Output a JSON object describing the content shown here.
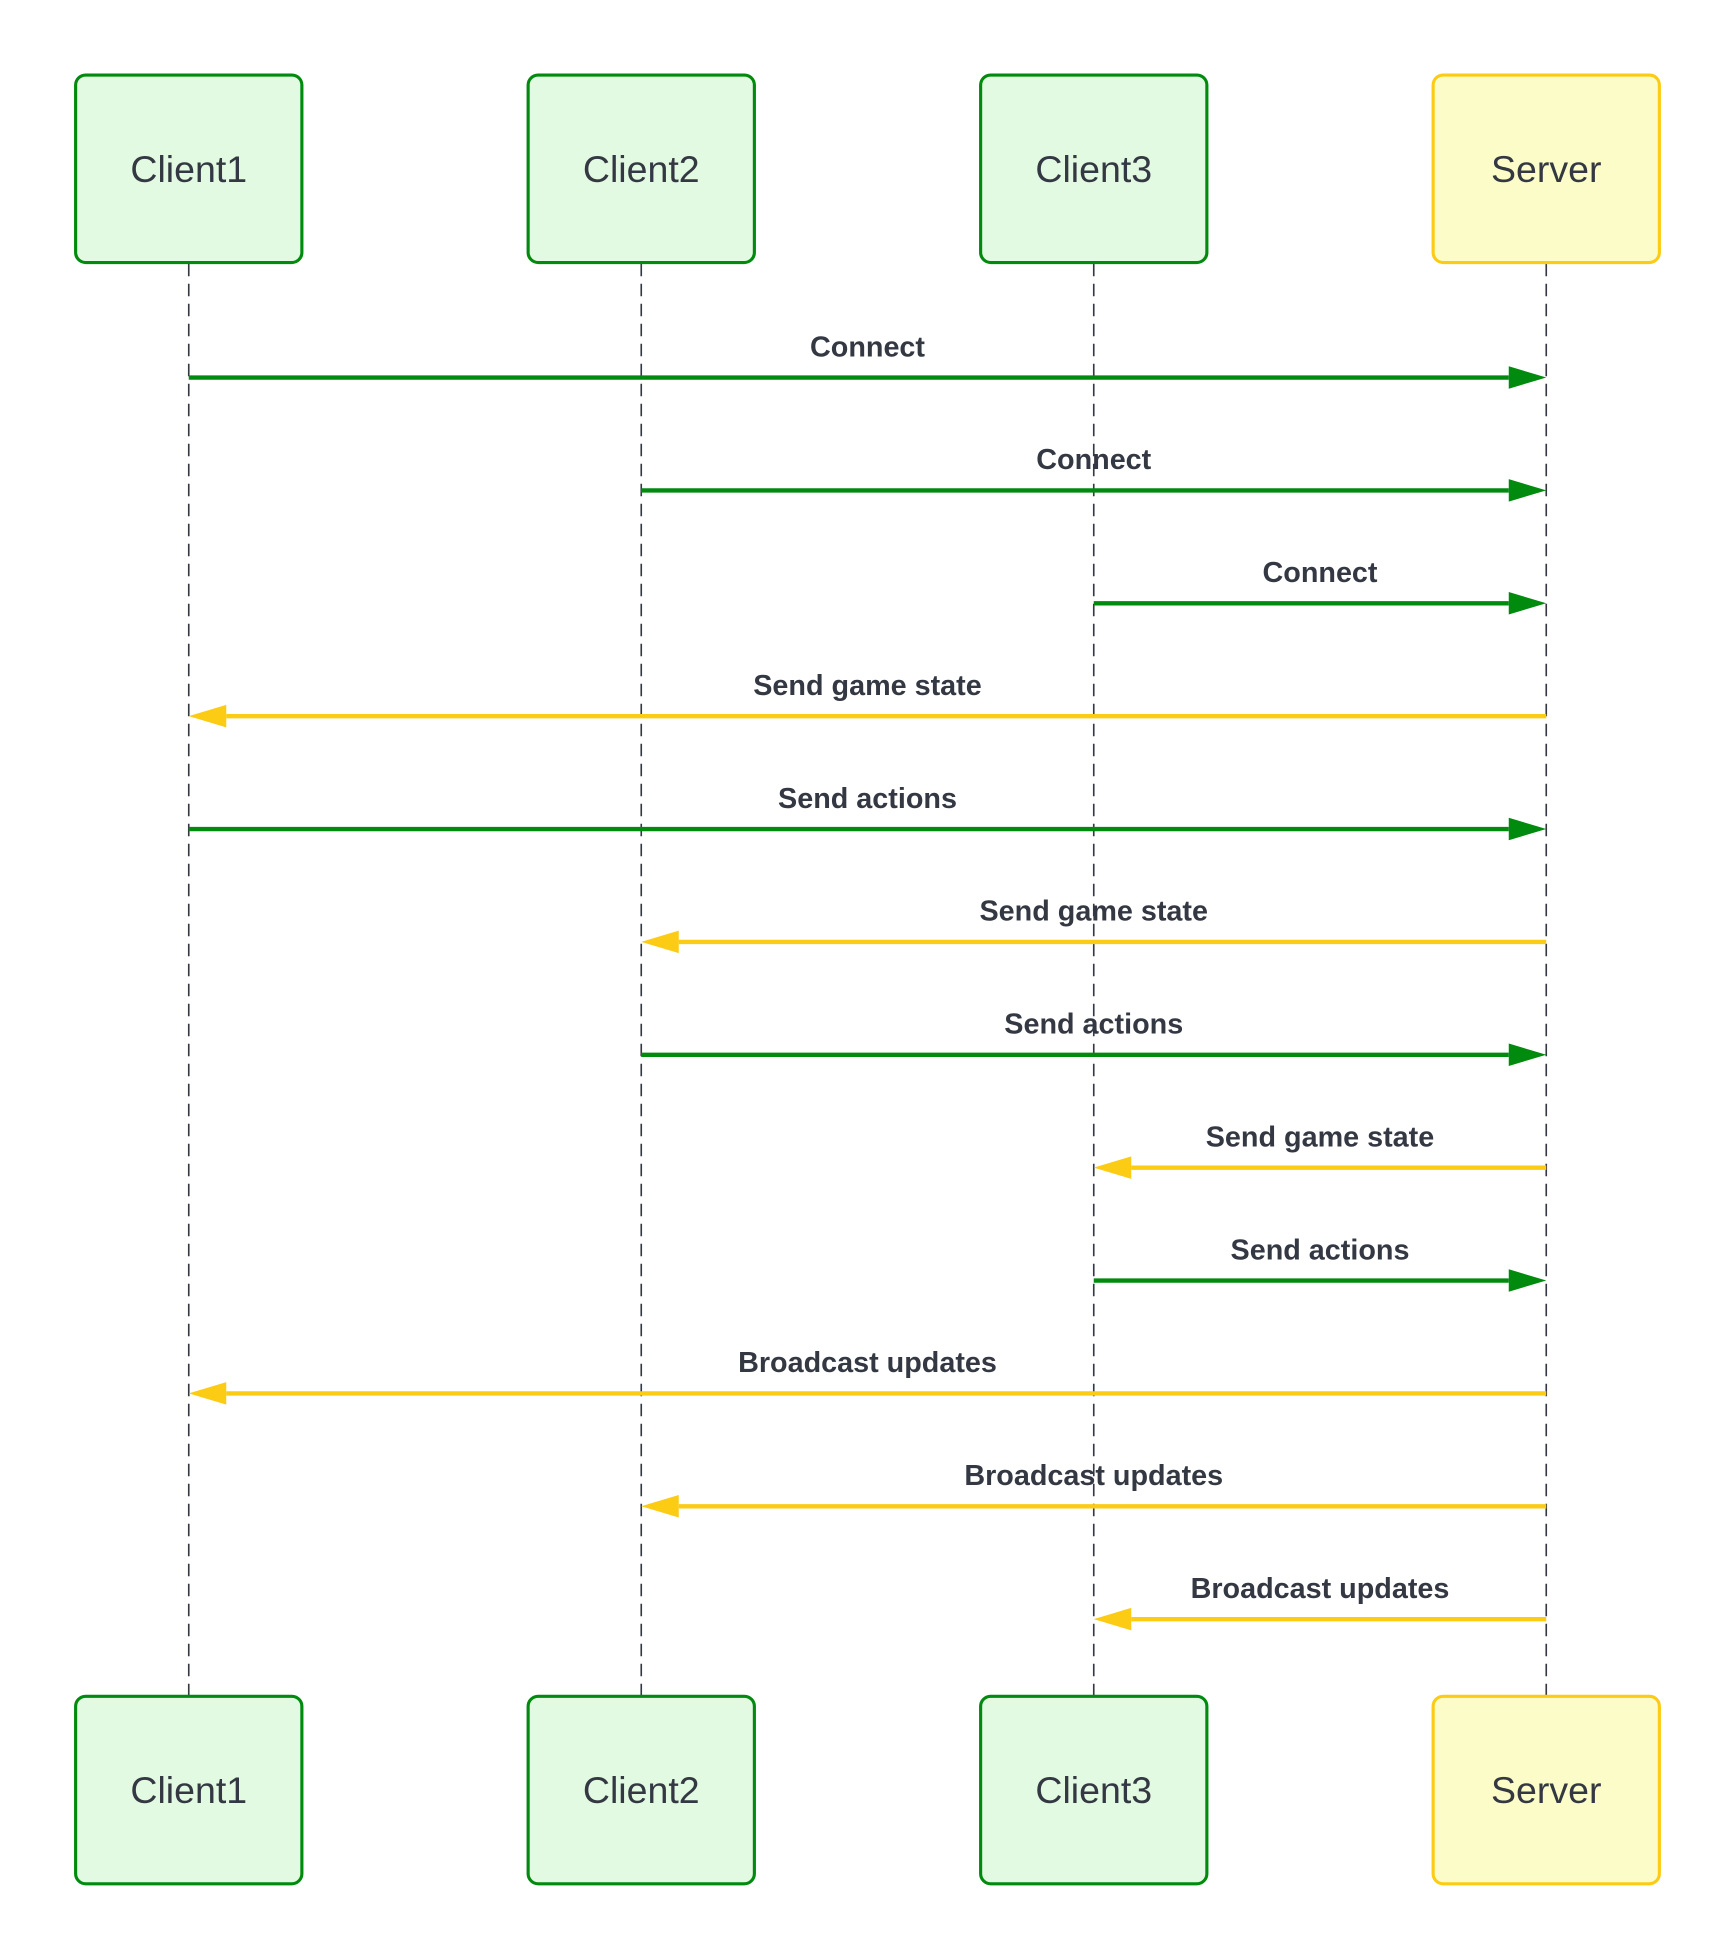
{
  "colors": {
    "client_fill": "#e2f9e2",
    "client_stroke": "#008a0e",
    "server_fill": "#fcfcc8",
    "server_stroke": "#fccb14",
    "lifeline": "#333842",
    "text": "#333842"
  },
  "actors": [
    {
      "id": "client1",
      "label": "Client1",
      "type": "client"
    },
    {
      "id": "client2",
      "label": "Client2",
      "type": "client"
    },
    {
      "id": "client3",
      "label": "Client3",
      "type": "client"
    },
    {
      "id": "server",
      "label": "Server",
      "type": "server"
    }
  ],
  "messages": [
    {
      "from": "client1",
      "to": "server",
      "label": "Connect"
    },
    {
      "from": "client2",
      "to": "server",
      "label": "Connect"
    },
    {
      "from": "client3",
      "to": "server",
      "label": "Connect"
    },
    {
      "from": "server",
      "to": "client1",
      "label": "Send game state"
    },
    {
      "from": "client1",
      "to": "server",
      "label": "Send actions"
    },
    {
      "from": "server",
      "to": "client2",
      "label": "Send game state"
    },
    {
      "from": "client2",
      "to": "server",
      "label": "Send actions"
    },
    {
      "from": "server",
      "to": "client3",
      "label": "Send game state"
    },
    {
      "from": "client3",
      "to": "server",
      "label": "Send actions"
    },
    {
      "from": "server",
      "to": "client1",
      "label": "Broadcast updates"
    },
    {
      "from": "server",
      "to": "client2",
      "label": "Broadcast updates"
    },
    {
      "from": "server",
      "to": "client3",
      "label": "Broadcast updates"
    }
  ]
}
